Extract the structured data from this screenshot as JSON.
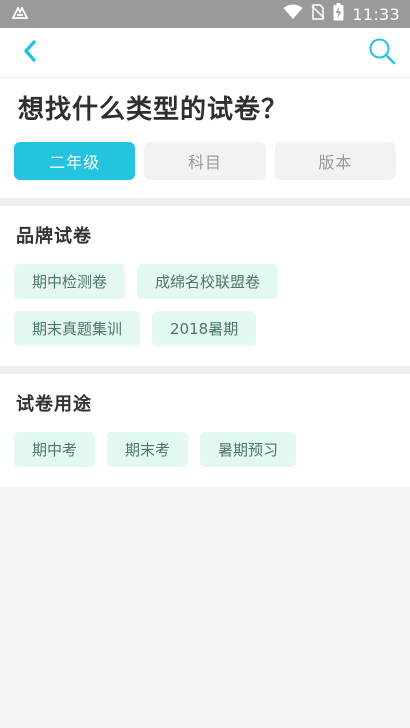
{
  "status_bar": {
    "time": "11:33",
    "icons": [
      "app-logo-icon",
      "wifi-icon",
      "no-sim-icon",
      "battery-charging-icon"
    ]
  },
  "nav": {
    "back_icon": "chevron-left-icon",
    "search_icon": "search-icon",
    "accent_color": "#24c4e0"
  },
  "hero": {
    "title": "想找什么类型的试卷？",
    "segments": [
      "二年级",
      "科目",
      "版本"
    ],
    "active_segment": 0
  },
  "sections": [
    {
      "title": "品牌试卷",
      "chips": [
        "期中检测卷",
        "成绵名校联盟卷",
        "期末真题集训",
        "2018暑期"
      ]
    },
    {
      "title": "试卷用途",
      "chips": [
        "期中考",
        "期末考",
        "暑期预习"
      ]
    }
  ],
  "colors": {
    "chip_bg": "#e3f8ee",
    "chip_text": "#4c7866",
    "active_segment": "#24c4e0",
    "inactive_segment": "#f1f2f4"
  }
}
